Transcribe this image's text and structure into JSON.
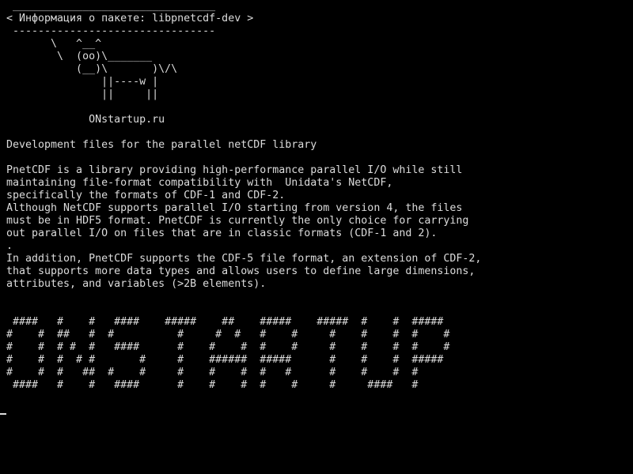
{
  "terminal": {
    "bubble_top": " ________________________________",
    "bubble_text": "< Информация о пакете: libpnetcdf-dev >",
    "bubble_bottom": " --------------------------------",
    "cow_art": [
      "       \\   ^__^",
      "        \\  (oo)\\_______",
      "           (__)\\       )\\/\\",
      "               ||----w |",
      "               ||     ||"
    ],
    "credit": "             ONstartup.ru",
    "summary": "Development files for the parallel netCDF library",
    "description": [
      "PnetCDF is a library providing high-performance parallel I/O while still",
      "maintaining file-format compatibility with  Unidata's NetCDF,",
      "specifically the formats of CDF-1 and CDF-2.",
      "Although NetCDF supports parallel I/O starting from version 4, the files",
      "must be in HDF5 format. PnetCDF is currently the only choice for carrying",
      "out parallel I/O on files that are in classic formats (CDF-1 and 2).",
      ".",
      "In addition, PnetCDF supports the CDF-5 file format, an extension of CDF-2,",
      "that supports more data types and allows users to define large dimensions,",
      "attributes, and variables (>2B elements)."
    ],
    "banner": [
      " ####   #    #   ####    #####    ##    #####    #####  #    #  #####",
      "#    #  ##   #  #          #     #  #   #    #     #    #    #  #    #",
      "#    #  # #  #   ####      #    #    #  #    #     #    #    #  #    #",
      "#    #  #  # #       #     #    ######  #####      #    #    #  #####",
      "#    #  #   ##  #    #     #    #    #  #   #      #    #    #  #",
      " ####   #    #   ####      #    #    #  #    #     #     ####   #"
    ]
  }
}
